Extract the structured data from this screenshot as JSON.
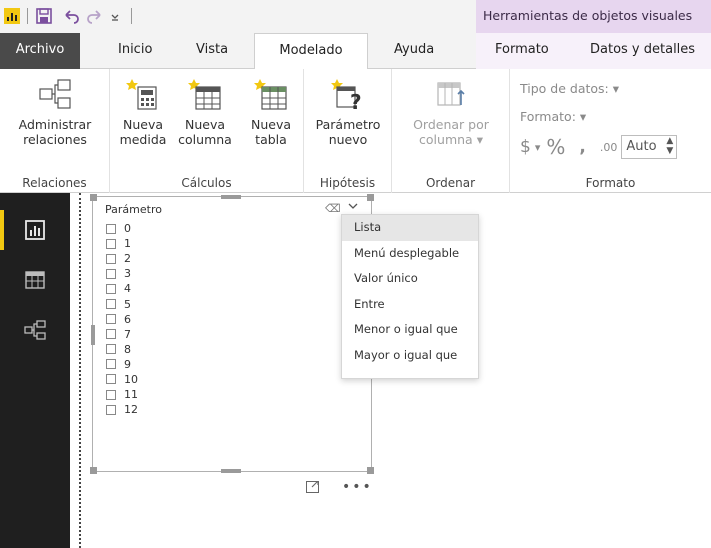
{
  "titlebar": {
    "context_tools_title": "Herramientas de objetos visuales"
  },
  "tabs": {
    "file": "Archivo",
    "home": "Inicio",
    "view": "Vista",
    "modeling": "Modelado",
    "help": "Ayuda",
    "format": "Formato",
    "data_details": "Datos y detalles"
  },
  "ribbon": {
    "manage_relationships": {
      "line1": "Administrar",
      "line2": "relaciones"
    },
    "new_measure": {
      "line1": "Nueva",
      "line2": "medida"
    },
    "new_column": {
      "line1": "Nueva",
      "line2": "columna"
    },
    "new_table": {
      "line1": "Nueva",
      "line2": "tabla"
    },
    "new_parameter": {
      "line1": "Parámetro",
      "line2": "nuevo"
    },
    "sort_by_column": {
      "line1": "Ordenar por",
      "line2": "columna"
    },
    "data_type_label": "Tipo de datos:",
    "format_label": "Formato:",
    "currency_symbol": "$",
    "percent_symbol": "%",
    "comma_symbol": ",",
    "decimal_symbol": ".00",
    "auto_value": "Auto",
    "groups": {
      "relationships": "Relaciones",
      "calculations": "Cálculos",
      "whatif": "Hipótesis",
      "sort": "Ordenar",
      "formatting": "Formato"
    }
  },
  "slicer": {
    "title": "Parámetro",
    "items": [
      "0",
      "1",
      "2",
      "3",
      "4",
      "5",
      "6",
      "7",
      "8",
      "9",
      "10",
      "11",
      "12"
    ]
  },
  "dropdown": {
    "options": [
      "Lista",
      "Menú desplegable",
      "Valor único",
      "Entre",
      "Menor o igual que",
      "Mayor o igual que"
    ],
    "selected": "Lista"
  },
  "colors": {
    "accent_yellow": "#f2c811",
    "context_purple": "#e7d6ef",
    "nav_dark": "#1f1f1f",
    "file_tab": "#4a4a4a"
  },
  "icons": {
    "app": "powerbi-logo-icon",
    "save": "save-icon",
    "undo": "undo-icon",
    "redo": "redo-icon",
    "nav_report": "report-view-icon",
    "nav_data": "data-view-icon",
    "nav_model": "model-view-icon"
  }
}
